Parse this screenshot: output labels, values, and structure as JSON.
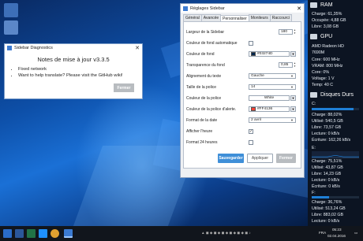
{
  "diagnostics": {
    "title": "Sidebar Diagnostics",
    "close_glyph": "✕",
    "heading": "Notes de mise à jour v3.3.5",
    "notes": [
      "Fixed network",
      "Want to help translate? Please visit the GitHub wiki!"
    ],
    "close_label": "Fermer"
  },
  "settings": {
    "title": "Réglages Sidebar",
    "close_glyph": "✕",
    "tabs": [
      "Général",
      "Avancée",
      "Personnaliser",
      "Moniteurs",
      "Raccourci"
    ],
    "active_tab": "Personnaliser",
    "fields": {
      "sidebar_width": {
        "label": "Largeur de la Sidebar",
        "value": "180"
      },
      "auto_bg": {
        "label": "Couleur de fond automatique",
        "checked": false
      },
      "bg_color": {
        "label": "Couleur de fond",
        "value": "#03274D",
        "swatch": "#03274D"
      },
      "bg_opacity": {
        "label": "Transparence du fond",
        "value": "0,85"
      },
      "text_align": {
        "label": "Alignement du texte",
        "value": "Gauche"
      },
      "font_size": {
        "label": "Taille de la police",
        "value": "14"
      },
      "font_color": {
        "label": "Couleur de la police",
        "value": "White",
        "swatch": "#FFFFFF"
      },
      "alert_color": {
        "label": "Couleur de la police d'alerte.",
        "value": "#FF4136",
        "swatch": "#FF4136"
      },
      "date_format": {
        "label": "Format de la date",
        "value": "2 avril"
      },
      "show_clock": {
        "label": "Afficher l'heure",
        "checked": true
      },
      "format_24h": {
        "label": "Format 24 heures",
        "checked": false
      }
    },
    "buttons": {
      "save": "Sauvegarder",
      "apply": "Appliquer",
      "close": "Fermer"
    }
  },
  "sidebar": {
    "ram": {
      "title": "RAM",
      "lines": [
        "Charge: 61,35%",
        "Occupée: 4,88 GB",
        "Libre: 3,08 GB"
      ],
      "load": 0.6135
    },
    "gpu": {
      "title": "GPU",
      "lines": [
        "AMD Radeon HD",
        "7690M",
        "Core: 600 MHz",
        "VRAM: 800 MHz",
        "Core: 0%",
        "Voltage: 1 V",
        "Temp: 40 C"
      ]
    },
    "disks": {
      "title": "Disques Durs",
      "drives": [
        {
          "name": "C:",
          "lines": [
            "Charge: 88,02%",
            "Utilisé: 540,5 GB",
            "Libre: 73,57 GB",
            "Lecture: 0 kB/s",
            "Écriture: 162,26 kB/s"
          ],
          "load": 0.8802
        },
        {
          "name": "E:",
          "lines": [
            "Charge: 75,51%",
            "Utilisé: 43,87 GB",
            "Libre: 14,23 GB",
            "Lecture: 0 kB/s",
            "Écriture: 0 kB/s"
          ],
          "load": 0.7551
        },
        {
          "name": "F:",
          "lines": [
            "Charge: 36,76%",
            "Utilisé: 513,24 GB",
            "Libre: 883,02 GB",
            "Lecture: 0 kB/s",
            "Écriture: 0 kB/s"
          ],
          "load": 0.3676
        }
      ]
    }
  },
  "taskbar": {
    "time": "05:23",
    "date": "02.04.2016",
    "language": "FRA"
  }
}
